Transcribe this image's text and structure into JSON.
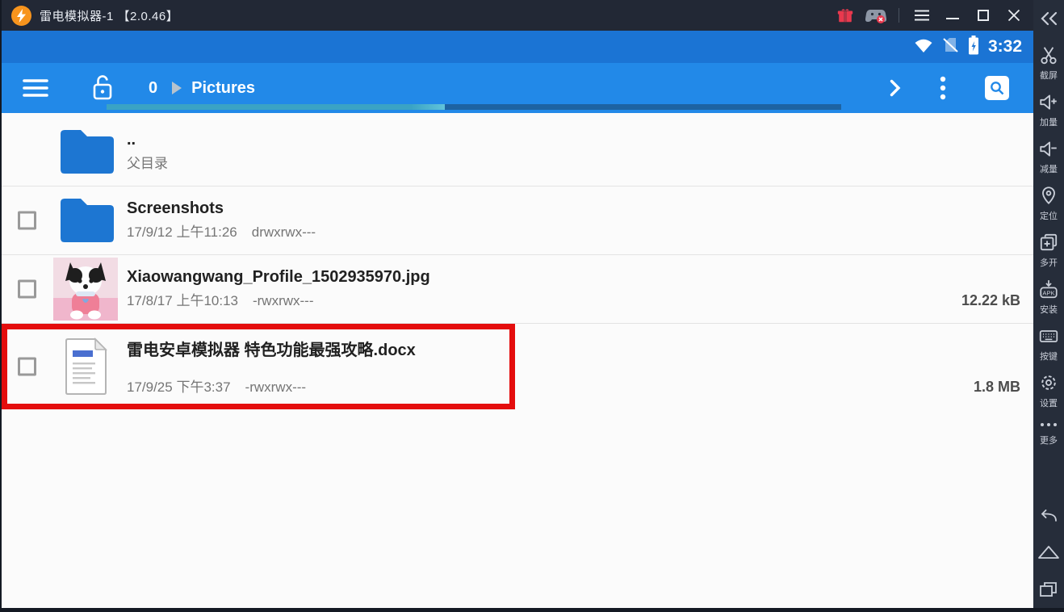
{
  "window": {
    "title": "雷电模拟器-1 【2.0.46】"
  },
  "status_bar": {
    "time": "3:32"
  },
  "toolbar": {
    "tab_count": "0",
    "breadcrumb": "Pictures",
    "progress_percent": 46
  },
  "file_list": [
    {
      "name": "..",
      "meta": "父目录",
      "date": "",
      "perms": "",
      "size": "",
      "icon": "folder",
      "checkbox": false
    },
    {
      "name": "Screenshots",
      "date": "17/9/12 上午11:26",
      "perms": "drwxrwx---",
      "size": "",
      "icon": "folder",
      "checkbox": true
    },
    {
      "name": "Xiaowangwang_Profile_1502935970.jpg",
      "date": "17/8/17 上午10:13",
      "perms": "-rwxrwx---",
      "size": "12.22 kB",
      "icon": "image-thumbnail",
      "checkbox": true
    },
    {
      "name": "雷电安卓模拟器 特色功能最强攻略.docx",
      "date": "17/9/25 下午3:37",
      "perms": "-rwxrwx---",
      "size": "1.8 MB",
      "icon": "document",
      "checkbox": true,
      "highlighted": true
    }
  ],
  "sidebar": {
    "items": [
      {
        "label": "截屏",
        "icon": "scissors"
      },
      {
        "label": "加量",
        "icon": "volume-up"
      },
      {
        "label": "减量",
        "icon": "volume-down"
      },
      {
        "label": "定位",
        "icon": "location-pin"
      },
      {
        "label": "多开",
        "icon": "multi-instance"
      },
      {
        "label": "安装",
        "icon": "apk-install"
      },
      {
        "label": "按键",
        "icon": "keyboard"
      },
      {
        "label": "设置",
        "icon": "settings-gear"
      },
      {
        "label": "更多",
        "icon": "more-dots"
      }
    ]
  },
  "colors": {
    "status_bar_blue": "#1b74d4",
    "toolbar_blue": "#2289e8",
    "titlebar_dark": "#222835",
    "sidebar_dark": "#262d3a",
    "highlight_red": "#e40d0d",
    "folder_blue": "#1d76d2",
    "progress_fill_teal": "#3aa3c5",
    "progress_track": "#1d63a2",
    "gift_red": "#e8394e"
  }
}
